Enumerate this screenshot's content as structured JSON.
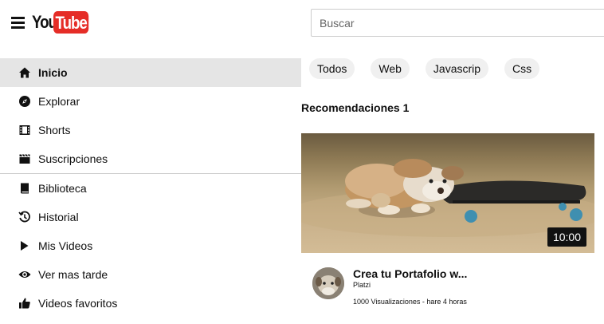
{
  "header": {
    "logo_you": "You",
    "logo_tube": "Tube",
    "search_placeholder": "Buscar"
  },
  "sidebar": {
    "items": [
      {
        "label": "Inicio",
        "icon": "home-icon",
        "active": true
      },
      {
        "label": "Explorar",
        "icon": "compass-icon"
      },
      {
        "label": "Shorts",
        "icon": "film-icon"
      },
      {
        "label": "Suscripciones",
        "icon": "clapperboard-icon"
      },
      {
        "label": "Biblioteca",
        "icon": "book-icon"
      },
      {
        "label": "Historial",
        "icon": "history-icon"
      },
      {
        "label": "Mis Videos",
        "icon": "play-icon"
      },
      {
        "label": "Ver mas tarde",
        "icon": "eye-icon"
      },
      {
        "label": "Videos favoritos",
        "icon": "thumbs-up-icon"
      }
    ]
  },
  "chips": [
    "Todos",
    "Web",
    "Javascrip",
    "Css"
  ],
  "section_title": "Recomendaciones 1",
  "video": {
    "duration": "10:00",
    "title": "Crea tu Portafolio w...",
    "channel": "Platzi",
    "meta": "1000 Visualizaciones - hare 4 horas"
  },
  "colors": {
    "brand_red": "#e52d27",
    "active_bg": "#e5e5e5",
    "chip_bg": "#f0f0f0"
  }
}
